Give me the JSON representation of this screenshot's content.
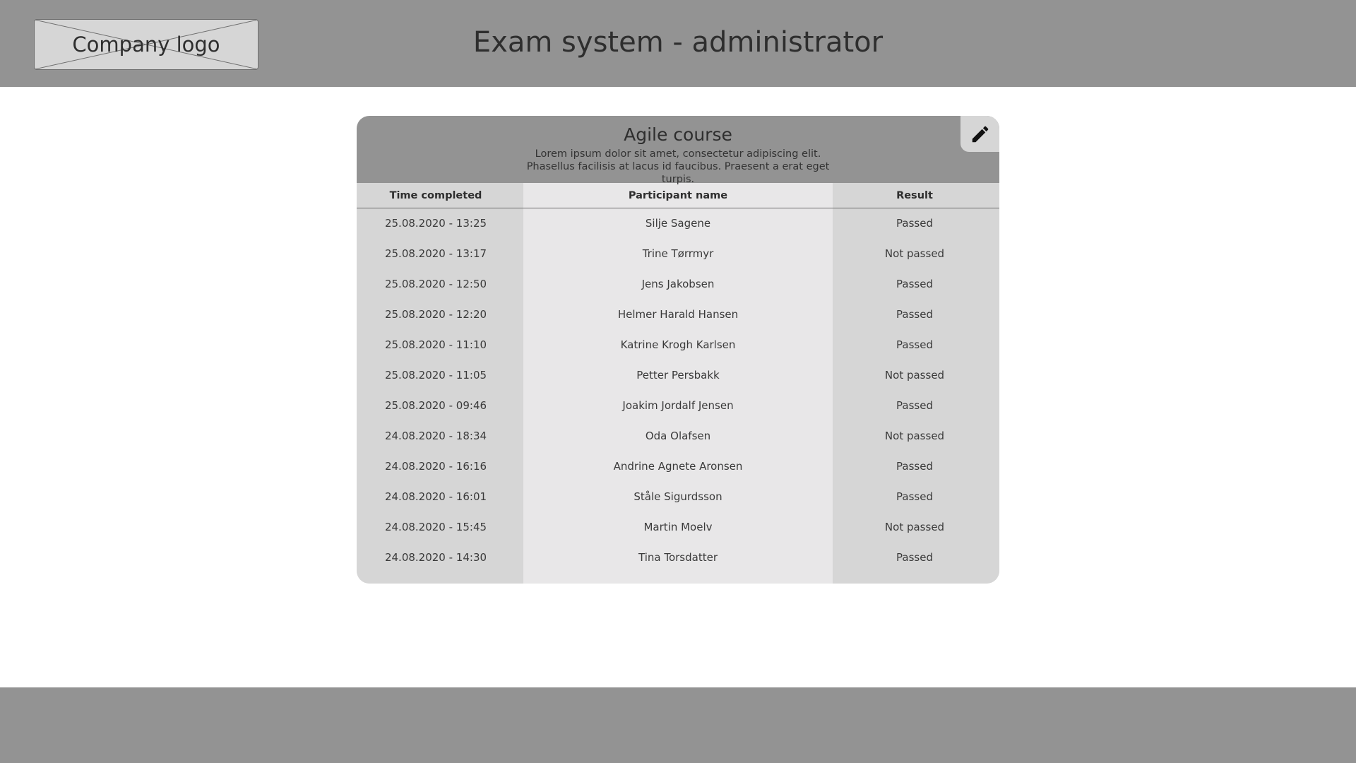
{
  "header": {
    "logo_text": "Company logo",
    "title": "Exam system - administrator"
  },
  "course": {
    "title": "Agile course",
    "description": "Lorem ipsum dolor sit amet, consectetur adipiscing elit. Phasellus facilisis at lacus id faucibus. Praesent a erat eget turpis.",
    "edit_icon": "pencil-icon"
  },
  "table": {
    "columns": [
      "Time completed",
      "Participant name",
      "Result"
    ],
    "rows": [
      {
        "time": "25.08.2020 - 13:25",
        "name": "Silje Sagene",
        "result": "Passed"
      },
      {
        "time": "25.08.2020 - 13:17",
        "name": "Trine Tørrmyr",
        "result": "Not passed"
      },
      {
        "time": "25.08.2020 - 12:50",
        "name": "Jens Jakobsen",
        "result": "Passed"
      },
      {
        "time": "25.08.2020 - 12:20",
        "name": "Helmer Harald Hansen",
        "result": "Passed"
      },
      {
        "time": "25.08.2020 - 11:10",
        "name": "Katrine Krogh Karlsen",
        "result": "Passed"
      },
      {
        "time": "25.08.2020 - 11:05",
        "name": "Petter Persbakk",
        "result": "Not passed"
      },
      {
        "time": "25.08.2020 - 09:46",
        "name": "Joakim Jordalf Jensen",
        "result": "Passed"
      },
      {
        "time": "24.08.2020 - 18:34",
        "name": "Oda Olafsen",
        "result": "Not passed"
      },
      {
        "time": "24.08.2020 - 16:16",
        "name": "Andrine Agnete Aronsen",
        "result": "Passed"
      },
      {
        "time": "24.08.2020 - 16:01",
        "name": "Ståle Sigurdsson",
        "result": "Passed"
      },
      {
        "time": "24.08.2020 - 15:45",
        "name": "Martin Moelv",
        "result": "Not passed"
      },
      {
        "time": "24.08.2020 - 14:30",
        "name": "Tina Torsdatter",
        "result": "Passed"
      }
    ]
  },
  "colors": {
    "header_bg": "#939393",
    "panel_light": "#d6d6d6",
    "panel_lighter": "#e8e7e8",
    "text": "#2e2e2e"
  }
}
